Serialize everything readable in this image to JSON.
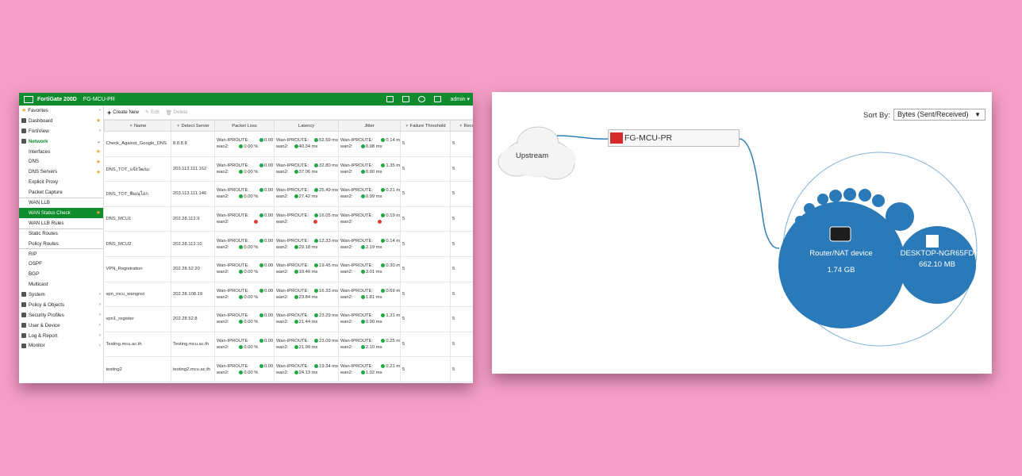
{
  "left_panel": {
    "header": {
      "model": "FortiGate 200D",
      "hostname": "FG-MCU-PR",
      "user": "admin"
    },
    "sidebar": [
      {
        "label": "Favorites",
        "icon": "star-icon",
        "type": "top",
        "chev": ">"
      },
      {
        "label": "Dashboard",
        "icon": "dashboard-icon",
        "type": "top",
        "fav": true
      },
      {
        "label": "FortiView",
        "icon": "fortiview-icon",
        "type": "top",
        "chev": ">"
      },
      {
        "label": "Network",
        "icon": "network-icon",
        "type": "open",
        "chev": "v"
      },
      {
        "label": "Interfaces",
        "type": "sub",
        "fav": true
      },
      {
        "label": "DNS",
        "type": "sub",
        "fav": true
      },
      {
        "label": "DNS Servers",
        "type": "sub",
        "fav": true
      },
      {
        "label": "Explicit Proxy",
        "type": "sub"
      },
      {
        "label": "Packet Capture",
        "type": "sub"
      },
      {
        "label": "WAN LLB",
        "type": "sub",
        "sep": true
      },
      {
        "label": "WAN Status Check",
        "type": "sub",
        "active": true,
        "fav": true
      },
      {
        "label": "WAN LLB Rules",
        "type": "sub"
      },
      {
        "label": "Static Routes",
        "type": "sub",
        "sep": true
      },
      {
        "label": "Policy Routes",
        "type": "sub"
      },
      {
        "label": "RIP",
        "type": "sub",
        "sep": true
      },
      {
        "label": "OSPF",
        "type": "sub"
      },
      {
        "label": "BGP",
        "type": "sub"
      },
      {
        "label": "Multicast",
        "type": "sub"
      },
      {
        "label": "System",
        "icon": "gear-icon",
        "type": "top",
        "chev": ">"
      },
      {
        "label": "Policy & Objects",
        "icon": "policy-icon",
        "type": "top",
        "chev": ">"
      },
      {
        "label": "Security Profiles",
        "icon": "lock-icon",
        "type": "top",
        "chev": ">"
      },
      {
        "label": "User & Device",
        "icon": "user-icon",
        "type": "top",
        "chev": ">"
      },
      {
        "label": "Log & Report",
        "icon": "chart-icon",
        "type": "top",
        "chev": ">"
      },
      {
        "label": "Monitor",
        "icon": "monitor-icon",
        "type": "top",
        "chev": ">"
      }
    ],
    "toolbar": {
      "create": "Create New",
      "edit": "Edit",
      "delete": "Delete"
    },
    "columns": [
      "Name",
      "Detect Server",
      "Packet Loss",
      "Latency",
      "Jitter",
      "Failure Threshold",
      "Recov"
    ],
    "rows": [
      {
        "name": "Check_Against_Google_DNS",
        "server": "8.8.8.8",
        "loss": [
          "0.00 %",
          "0.00 %"
        ],
        "lat": [
          "52.59 ms",
          "40.34 ms"
        ],
        "jit": [
          "0.14 ms",
          "0.98 ms"
        ],
        "fail": "5",
        "rec": "5"
      },
      {
        "name": "DNS_TOT_แจ้งวัฒนะ",
        "server": "203.113.111.162",
        "loss": [
          "0.00 %",
          "0.00 %"
        ],
        "lat": [
          "32.80 ms",
          "37.06 ms"
        ],
        "jit": [
          "1.35 ms",
          "0.90 ms"
        ],
        "fail": "5",
        "rec": "5"
      },
      {
        "name": "DNS_TOT_พิษณุโลก",
        "server": "203.113.111.146",
        "loss": [
          "0.00 %",
          "0.00 %"
        ],
        "lat": [
          "25.49 ms",
          "27.42 ms"
        ],
        "jit": [
          "0.21 ms",
          "0.99 ms"
        ],
        "fail": "5",
        "rec": "5"
      },
      {
        "name": "DNS_MCU1",
        "server": "202.28.112.9",
        "loss": [
          "0.00 %",
          ""
        ],
        "lat": [
          "16.05 ms",
          ""
        ],
        "jit": [
          "0.19 ms",
          ""
        ],
        "fail": "5",
        "rec": "5",
        "down2": true
      },
      {
        "name": "DNS_MCU2",
        "server": "202.28.112.10",
        "loss": [
          "0.00 %",
          "0.00 %"
        ],
        "lat": [
          "12.33 ms",
          "29.18 ms"
        ],
        "jit": [
          "0.14 ms",
          "2.19 ms"
        ],
        "fail": "5",
        "rec": "5"
      },
      {
        "name": "VPN_Registration",
        "server": "202.28.52.20",
        "loss": [
          "0.00 %",
          "0.00 %"
        ],
        "lat": [
          "19.45 ms",
          "19.46 ms"
        ],
        "jit": [
          "0.30 ms",
          "3.01 ms"
        ],
        "fail": "5",
        "rec": "5"
      },
      {
        "name": "vpn_mcu_wangnoi",
        "server": "202.28.108.19",
        "loss": [
          "0.00 %",
          "0.00 %"
        ],
        "lat": [
          "16.33 ms",
          "23.84 ms"
        ],
        "jit": [
          "0.69 ms",
          "1.81 ms"
        ],
        "fail": "5",
        "rec": "5"
      },
      {
        "name": "vpn1_register",
        "server": "202.28.52.8",
        "loss": [
          "0.00 %",
          "0.00 %"
        ],
        "lat": [
          "23.29 ms",
          "21.44 ms"
        ],
        "jit": [
          "1.31 ms",
          "0.90 ms"
        ],
        "fail": "5",
        "rec": "5"
      },
      {
        "name": "Testing.mcu.ac.th",
        "server": "Testing.mcu.ac.th",
        "loss": [
          "0.00 %",
          "0.00 %"
        ],
        "lat": [
          "23.09 ms",
          "21.99 ms"
        ],
        "jit": [
          "0.25 ms",
          "2.10 ms"
        ],
        "fail": "5",
        "rec": "5"
      },
      {
        "name": "testing2",
        "server": "testing2.mcu.ac.th",
        "loss": [
          "0.00 %",
          "0.00 %"
        ],
        "lat": [
          "19.34 ms",
          "24.13 ms"
        ],
        "jit": [
          "0.21 ms",
          "1.02 ms"
        ],
        "fail": "5",
        "rec": "5"
      }
    ],
    "wan1_label": "Wan-IPROUTE:",
    "wan2_label": "wan2:"
  },
  "right_panel": {
    "sort_label": "Sort By:",
    "sort_value": "Bytes (Sent/Received)",
    "upstream": "Upstream",
    "device": "FG-MCU-PR",
    "bubbles": [
      {
        "name": "Router/NAT device",
        "value": "1.74 GB"
      },
      {
        "name": "DESKTOP-NGR65FD",
        "value": "662.10 MB"
      }
    ],
    "colors": {
      "bubble": "#2a79b9",
      "line": "#2e7fb5"
    }
  }
}
